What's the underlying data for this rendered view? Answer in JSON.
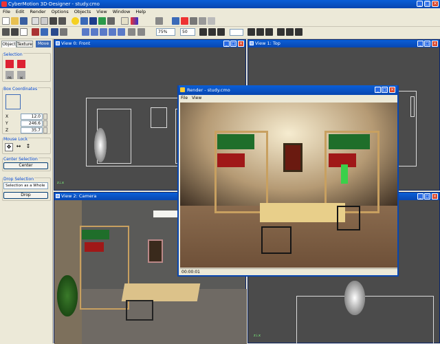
{
  "app": {
    "title": "CyberMotion 3D-Designer - study.cmo"
  },
  "menu": [
    "File",
    "Edit",
    "Render",
    "Options",
    "Objects",
    "View",
    "Window",
    "Help"
  ],
  "toolbar2": {
    "zoom": "75%",
    "step": "50"
  },
  "left_panel": {
    "tabs": [
      "Object",
      "Texture",
      "Move"
    ],
    "selection": {
      "title": "Selection",
      "labels": [
        "PR",
        "IK"
      ]
    },
    "box_coordinates": {
      "title": "Box Coordinates",
      "fields": [
        {
          "label": "X",
          "value": "12.0"
        },
        {
          "label": "Y",
          "value": "246.6"
        },
        {
          "label": "Z",
          "value": "35.7"
        }
      ]
    },
    "mouse_lock": {
      "title": "Mouse Lock"
    },
    "center_selection": {
      "title": "Center Selection",
      "button": "Center"
    },
    "drop_selection": {
      "title": "Drop Selection",
      "mode": "Selection as a Whole",
      "button": "Drop"
    }
  },
  "views": [
    {
      "title": "View 0:   Front"
    },
    {
      "title": "View 1:   Top"
    },
    {
      "title": "View 2:   Camera"
    }
  ],
  "render_window": {
    "title": "Render - study.cmo",
    "menu": [
      "File",
      "View"
    ],
    "status": "00:00:01"
  },
  "colors": {
    "accent": "#0a5fd8",
    "close": "#d9462c",
    "viewport_bg": "#4b4b4b",
    "panel_bg": "#ece9d8"
  }
}
